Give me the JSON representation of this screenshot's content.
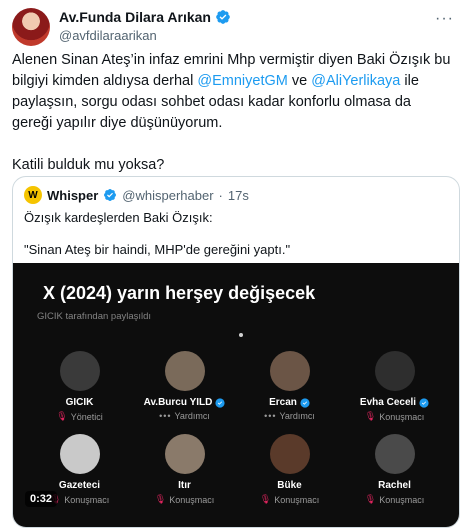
{
  "author": {
    "name": "Av.Funda Dilara Arıkan",
    "handle": "@avfdilaraarikan",
    "more_icon": "more-horizontal-icon"
  },
  "tweet": {
    "line_part1": "Alenen Sinan Ateş’in infaz emrini Mhp vermiştir diyen Baki Özışık bu bilgiyi kimden aldıysa derhal ",
    "mention1": "@EmniyetGM",
    "connector": " ve ",
    "mention2": "@AliYerlikaya",
    "line_part2": " ile paylaşsın, sorgu odası sohbet odası kadar konforlu olmasa da gereği yapılır diye düşünüyorum.",
    "para2": "Katili bulduk mu yoksa?"
  },
  "quote": {
    "name": "Whisper",
    "handle": "@whisperhaber",
    "separator": "·",
    "time": "17s",
    "line1": "Özışık kardeşlerden Baki Özışık:",
    "line2": "\"Sinan Ateş bir haindi, MHP'de gereğini yaptı.\""
  },
  "video": {
    "title": "X (2024) yarın herşey değişecek",
    "subtitle": "GICIK tarafından paylaşıldı",
    "duration": "0:32",
    "participants": [
      {
        "name": "GICIK",
        "role": "Yönetici",
        "verified": false,
        "role_type": "host"
      },
      {
        "name": "Av.Burcu YILD",
        "role": "Yardımcı",
        "verified": true,
        "role_type": "cohost"
      },
      {
        "name": "Ercan",
        "role": "Yardımcı",
        "verified": true,
        "role_type": "cohost"
      },
      {
        "name": "Evha Ceceli",
        "role": "Konuşmacı",
        "verified": true,
        "role_type": "speaker"
      },
      {
        "name": "Gazeteci",
        "role": "Konuşmacı",
        "verified": false,
        "role_type": "speaker"
      },
      {
        "name": "Itır",
        "role": "Konuşmacı",
        "verified": false,
        "role_type": "speaker"
      },
      {
        "name": "Büke",
        "role": "Konuşmacı",
        "verified": false,
        "role_type": "speaker"
      },
      {
        "name": "Rachel",
        "role": "Konuşmacı",
        "verified": false,
        "role_type": "speaker"
      }
    ]
  },
  "colors": {
    "verified_blue": "#1d9bf0",
    "mention_blue": "#1d9bf0",
    "secondary_text": "#536471",
    "whisper_yellow": "#f5c400"
  }
}
